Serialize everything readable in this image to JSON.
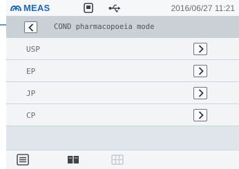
{
  "statusbar": {
    "brand": "MEAS",
    "datetime": "2016/06/27  11:21",
    "icons": [
      "meas-logo-icon",
      "storage-icon",
      "usb-icon"
    ]
  },
  "titlebar": {
    "back_icon": "chevron-left-icon",
    "title": "COND pharmacopoeia mode"
  },
  "list": {
    "items": [
      {
        "label": "USP"
      },
      {
        "label": "EP"
      },
      {
        "label": "JP"
      },
      {
        "label": "CP"
      }
    ],
    "arrow_icon": "chevron-right-icon"
  },
  "toolbar": {
    "buttons": [
      {
        "icon": "list-icon",
        "enabled": true
      },
      {
        "icon": "book-icon",
        "enabled": true
      },
      {
        "icon": "grid-icon",
        "enabled": false
      }
    ]
  },
  "colors": {
    "brand": "#1767c4",
    "background": "#dfe5ea",
    "row": "#f2f4f6",
    "titlebar": "#c9d0d6",
    "leader_line": "#5a9ac8"
  }
}
